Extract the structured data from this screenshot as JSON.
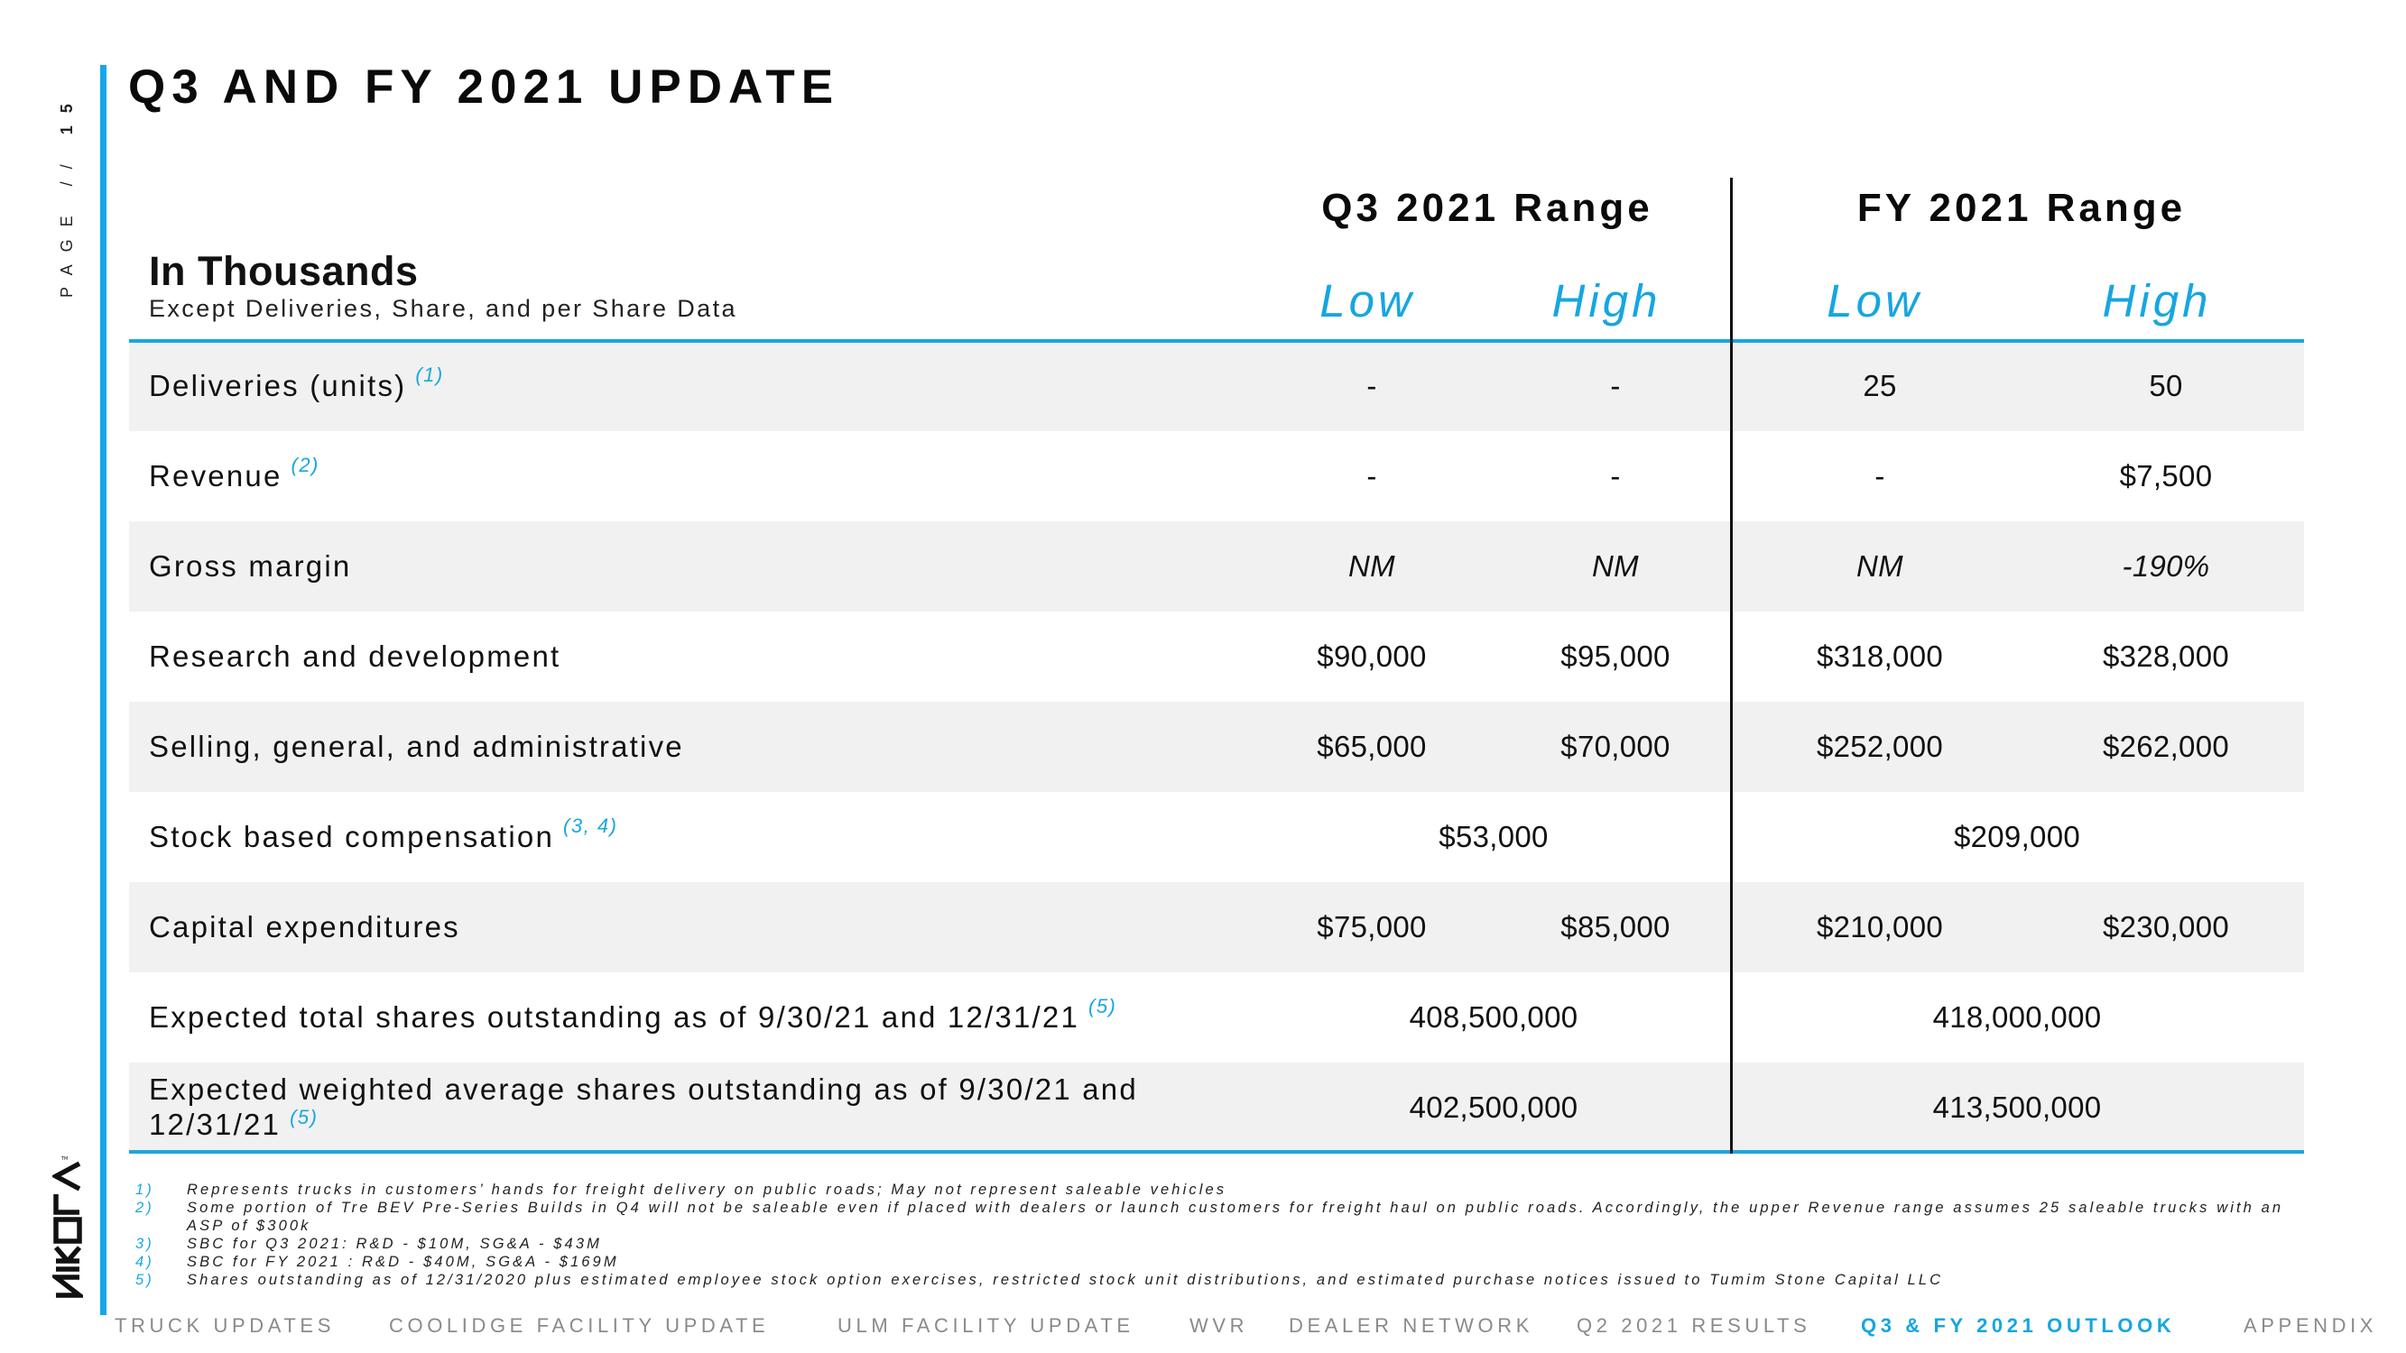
{
  "page": {
    "label_prefix": "PAGE //",
    "number": "15",
    "title": "Q3 AND FY 2021 UPDATE"
  },
  "units": {
    "heading": "In Thousands",
    "subheading": "Except Deliveries, Share, and per Share Data"
  },
  "groups": [
    {
      "label": "Q3 2021 Range",
      "columns": [
        "Low",
        "High"
      ]
    },
    {
      "label": "FY 2021 Range",
      "columns": [
        "Low",
        "High"
      ]
    }
  ],
  "rows": [
    {
      "label": "Deliveries (units)",
      "note": "(1)",
      "q3_low": "-",
      "q3_high": "-",
      "fy_low": "25",
      "fy_high": "50"
    },
    {
      "label": "Revenue",
      "note": "(2)",
      "q3_low": "-",
      "q3_high": "-",
      "fy_low": "-",
      "fy_high": "$7,500"
    },
    {
      "label": "Gross margin",
      "note": "",
      "q3_low": "NM",
      "q3_high": "NM",
      "fy_low": "NM",
      "fy_high": "-190%"
    },
    {
      "label": "Research and development",
      "note": "",
      "q3_low": "$90,000",
      "q3_high": "$95,000",
      "fy_low": "$318,000",
      "fy_high": "$328,000"
    },
    {
      "label": "Selling, general, and administrative",
      "note": "",
      "q3_low": "$65,000",
      "q3_high": "$70,000",
      "fy_low": "$252,000",
      "fy_high": "$262,000"
    },
    {
      "label": "Stock based compensation",
      "note": "(3, 4)",
      "q3_value": "$53,000",
      "fy_value": "$209,000"
    },
    {
      "label": "Capital expenditures",
      "note": "",
      "q3_low": "$75,000",
      "q3_high": "$85,000",
      "fy_low": "$210,000",
      "fy_high": "$230,000"
    },
    {
      "label": "Expected total shares outstanding as of 9/30/21 and 12/31/21",
      "note": "(5)",
      "q3_value": "408,500,000",
      "fy_value": "418,000,000"
    },
    {
      "label": "Expected weighted average shares outstanding as of 9/30/21 and 12/31/21",
      "note": "(5)",
      "q3_value": "402,500,000",
      "fy_value": "413,500,000"
    }
  ],
  "footnotes": [
    {
      "num": "1)",
      "text": "Represents trucks in customers’ hands for freight delivery on public roads; May not represent saleable vehicles"
    },
    {
      "num": "2)",
      "text": "Some portion of Tre BEV Pre-Series Builds in Q4 will not be saleable even if placed with dealers or launch customers for freight haul on public roads. Accordingly, the upper Revenue range assumes 25 saleable trucks with an ASP of $300k"
    },
    {
      "num": "3)",
      "text": "SBC for Q3 2021: R&D - $10M, SG&A - $43M"
    },
    {
      "num": "4)",
      "text": "SBC for FY 2021 : R&D - $40M, SG&A - $169M"
    },
    {
      "num": "5)",
      "text": "Shares outstanding as of 12/31/2020 plus estimated employee stock option exercises, restricted stock unit distributions, and estimated purchase notices issued to Tumim Stone Capital LLC"
    }
  ],
  "brand": {
    "logo_text": "NIKOLA",
    "logo_icon": "nikola-wordmark-icon"
  },
  "nav": [
    {
      "label": "TRUCK UPDATES",
      "active": false
    },
    {
      "label": "COOLIDGE FACILITY UPDATE",
      "active": false
    },
    {
      "label": "ULM FACILITY UPDATE",
      "active": false
    },
    {
      "label": "WVR",
      "active": false
    },
    {
      "label": "DEALER NETWORK",
      "active": false
    },
    {
      "label": "Q2 2021 RESULTS",
      "active": false
    },
    {
      "label": "Q3 & FY 2021 OUTLOOK",
      "active": true
    },
    {
      "label": "APPENDIX",
      "active": false
    }
  ],
  "colors": {
    "accent": "#16a6e0",
    "row_shade": "#f1f1f1",
    "nav_inactive": "#8a8a8a"
  }
}
